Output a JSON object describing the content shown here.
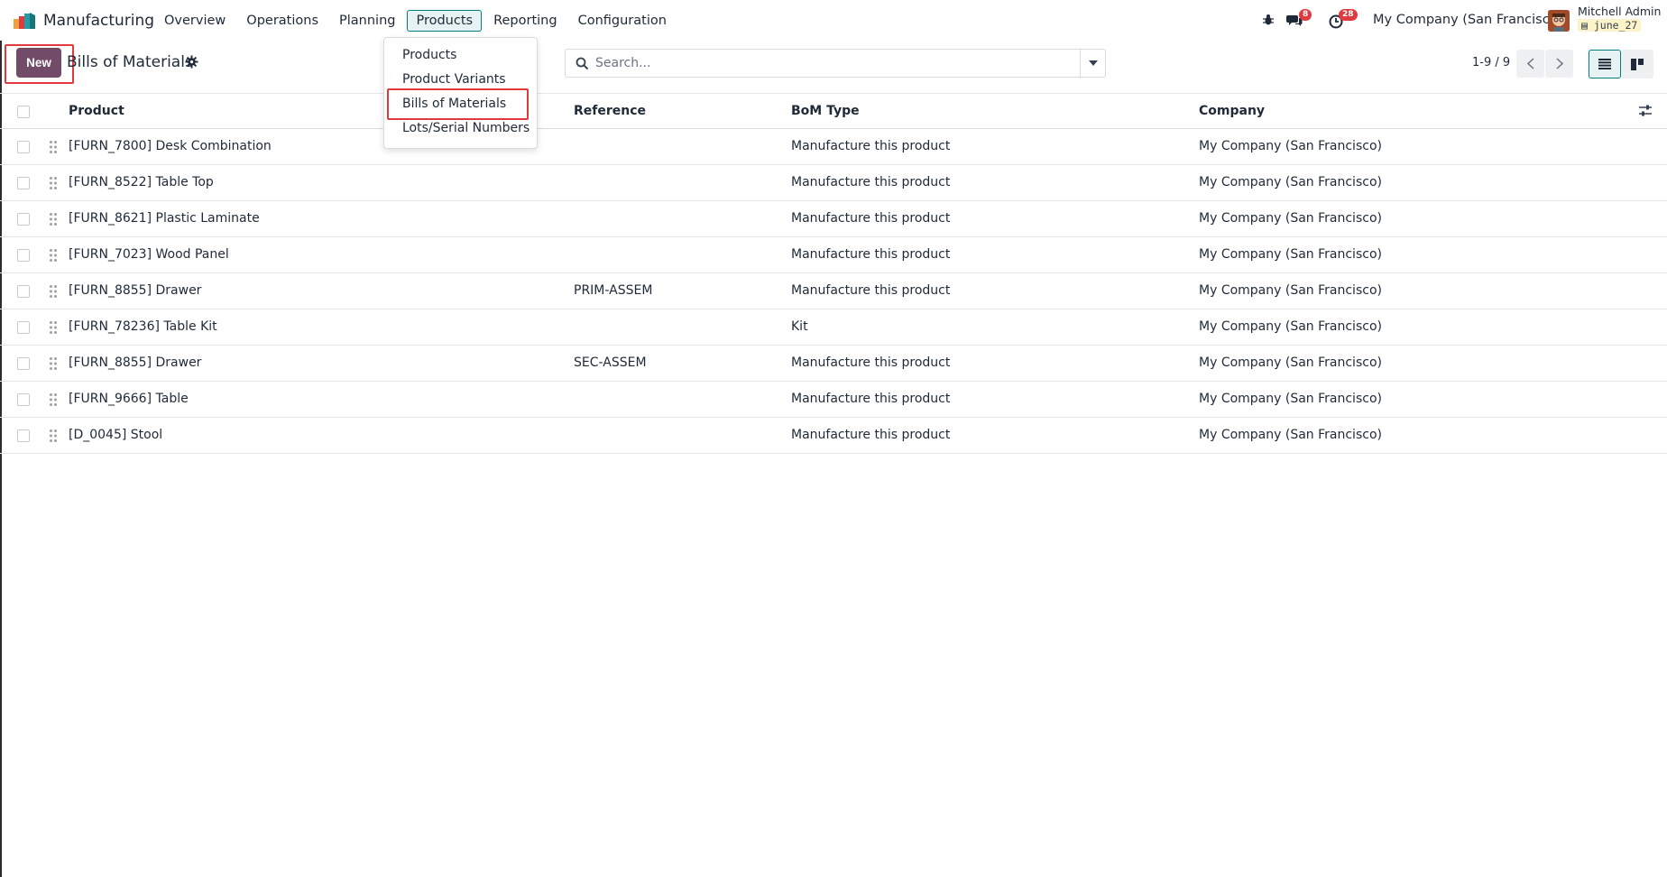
{
  "app": {
    "name": "Manufacturing"
  },
  "nav": {
    "items": [
      {
        "label": "Overview"
      },
      {
        "label": "Operations"
      },
      {
        "label": "Planning"
      },
      {
        "label": "Products",
        "active": true
      },
      {
        "label": "Reporting"
      },
      {
        "label": "Configuration"
      }
    ]
  },
  "systray": {
    "messages_count": "8",
    "activities_count": "28",
    "company": "My Company (San Francisco)",
    "user_name": "Mitchell Admin",
    "database": "june_27"
  },
  "control": {
    "new_label": "New",
    "title": "Bills of Materials",
    "search_placeholder": "Search...",
    "pager": "1-9 / 9"
  },
  "dropdown": {
    "items": [
      {
        "label": "Products"
      },
      {
        "label": "Product Variants"
      },
      {
        "label": "Bills of Materials",
        "highlighted": true
      },
      {
        "label": "Lots/Serial Numbers"
      }
    ]
  },
  "table": {
    "columns": {
      "product": "Product",
      "reference": "Reference",
      "bom_type": "BoM Type",
      "company": "Company"
    },
    "rows": [
      {
        "product": "[FURN_7800] Desk Combination",
        "reference": "",
        "bom_type": "Manufacture this product",
        "company": "My Company (San Francisco)"
      },
      {
        "product": "[FURN_8522] Table Top",
        "reference": "",
        "bom_type": "Manufacture this product",
        "company": "My Company (San Francisco)"
      },
      {
        "product": "[FURN_8621] Plastic Laminate",
        "reference": "",
        "bom_type": "Manufacture this product",
        "company": "My Company (San Francisco)"
      },
      {
        "product": "[FURN_7023] Wood Panel",
        "reference": "",
        "bom_type": "Manufacture this product",
        "company": "My Company (San Francisco)"
      },
      {
        "product": "[FURN_8855] Drawer",
        "reference": "PRIM-ASSEM",
        "bom_type": "Manufacture this product",
        "company": "My Company (San Francisco)"
      },
      {
        "product": "[FURN_78236] Table Kit",
        "reference": "",
        "bom_type": "Kit",
        "company": "My Company (San Francisco)"
      },
      {
        "product": "[FURN_8855] Drawer",
        "reference": "SEC-ASSEM",
        "bom_type": "Manufacture this product",
        "company": "My Company (San Francisco)"
      },
      {
        "product": "[FURN_9666] Table",
        "reference": "",
        "bom_type": "Manufacture this product",
        "company": "My Company (San Francisco)"
      },
      {
        "product": "[D_0045] Stool",
        "reference": "",
        "bom_type": "Manufacture this product",
        "company": "My Company (San Francisco)"
      }
    ]
  },
  "colors": {
    "primary": "#714b67",
    "accent": "#017e84",
    "highlight": "#e0393e",
    "badge": "#e0393e"
  }
}
